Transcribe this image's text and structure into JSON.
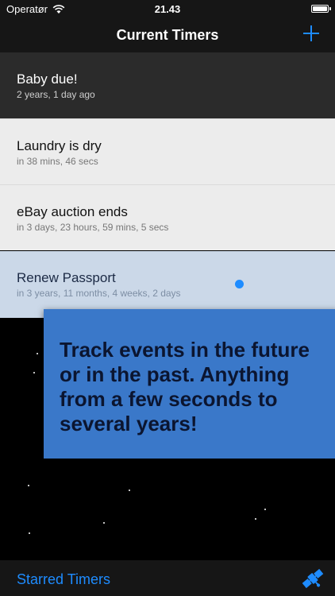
{
  "status_bar": {
    "carrier": "Operatør",
    "time": "21.43",
    "icons": [
      "wifi-icon",
      "battery-icon"
    ]
  },
  "nav": {
    "title": "Current Timers",
    "add_icon": "plus-icon"
  },
  "timers": [
    {
      "title": "Baby due!",
      "subtitle": "2 years, 1 day ago"
    },
    {
      "title": "Laundry is dry",
      "subtitle": "in 38 mins, 46 secs"
    },
    {
      "title": "eBay auction ends",
      "subtitle": "in 3 days, 23 hours, 59 mins, 5 secs"
    },
    {
      "title": "Renew Passport",
      "subtitle": "in 3 years, 11 months, 4 weeks, 2 days"
    }
  ],
  "callout": {
    "text": "Track events in the future or in the past. Anything from a few seconds to several years!"
  },
  "tab_bar": {
    "starred_label": "Starred Timers",
    "satellite_icon": "satellite-icon"
  },
  "colors": {
    "accent": "#1e8cff",
    "callout_bg": "#3a78c9",
    "selected_row": "#cbd8e8"
  }
}
